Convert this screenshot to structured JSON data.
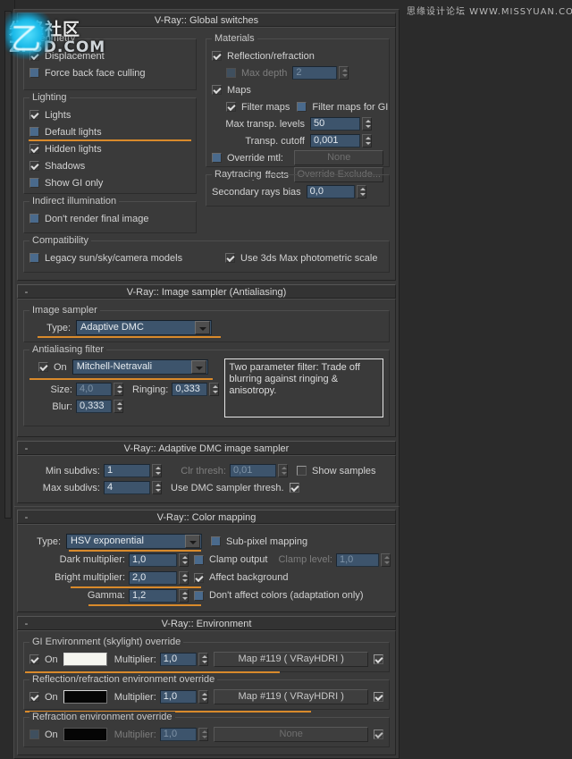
{
  "watermarks": {
    "right": "思缘设计论坛 WWW.MISSYUAN.COM",
    "left_cn": "朱峰社区",
    "left_domain": "ZF3D.COM"
  },
  "icons": {
    "collapse": "-",
    "spinner": "spinner-up-down-icon",
    "dropdown_arrow": "chevron-down-icon"
  },
  "rollouts": {
    "global_switches": {
      "title": "V-Ray:: Global switches",
      "geometry": {
        "legend": "Geometry",
        "displacement": {
          "label": "Displacement",
          "checked": true
        },
        "force_back_face_culling": {
          "label": "Force back face culling",
          "checked": false
        }
      },
      "lighting": {
        "legend": "Lighting",
        "lights": {
          "label": "Lights",
          "checked": true
        },
        "default_lights": {
          "label": "Default lights",
          "checked": false
        },
        "hidden_lights": {
          "label": "Hidden lights",
          "checked": true
        },
        "shadows": {
          "label": "Shadows",
          "checked": true
        },
        "show_gi_only": {
          "label": "Show GI only",
          "checked": false
        }
      },
      "indirect_illumination": {
        "legend": "Indirect illumination",
        "dont_render_final_image": {
          "label": "Don't render final image",
          "checked": false
        }
      },
      "compatibility": {
        "legend": "Compatibility",
        "legacy_sun": {
          "label": "Legacy sun/sky/camera models",
          "checked": false
        },
        "photometric_scale": {
          "label": "Use 3ds Max photometric scale",
          "checked": true
        }
      },
      "materials": {
        "legend": "Materials",
        "reflection_refraction": {
          "label": "Reflection/refraction",
          "checked": true
        },
        "max_depth": {
          "label": "Max depth",
          "checked": false,
          "value": "2"
        },
        "maps": {
          "label": "Maps",
          "checked": true
        },
        "filter_maps": {
          "label": "Filter maps",
          "checked": true
        },
        "filter_maps_gi": {
          "label": "Filter maps for GI",
          "checked": false
        },
        "max_transp_levels": {
          "label": "Max transp. levels",
          "value": "50"
        },
        "transp_cutoff": {
          "label": "Transp. cutoff",
          "value": "0,001"
        },
        "override_mtl": {
          "label": "Override mtl:",
          "checked": false,
          "button": "None"
        },
        "glossy_effects": {
          "label": "Glossy effects",
          "checked": true,
          "button": "Override Exclude..."
        }
      },
      "raytracing": {
        "legend": "Raytracing",
        "secondary_rays_bias": {
          "label": "Secondary rays bias",
          "value": "0,0"
        }
      }
    },
    "image_sampler": {
      "title": "V-Ray:: Image sampler (Antialiasing)",
      "sampler": {
        "legend": "Image sampler",
        "type_label": "Type:",
        "type_value": "Adaptive DMC"
      },
      "aa_filter": {
        "legend": "Antialiasing filter",
        "on_label": "On",
        "on_checked": true,
        "filter_value": "Mitchell-Netravali",
        "size_label": "Size:",
        "size_value": "4,0",
        "ringing_label": "Ringing:",
        "ringing_value": "0,333",
        "blur_label": "Blur:",
        "blur_value": "0,333",
        "description": "Two parameter filter: Trade off blurring against ringing & anisotropy."
      }
    },
    "adaptive_dmc": {
      "title": "V-Ray:: Adaptive DMC image sampler",
      "min_subdivs": {
        "label": "Min subdivs:",
        "value": "1"
      },
      "max_subdivs": {
        "label": "Max subdivs:",
        "value": "4"
      },
      "clr_thresh": {
        "label": "Clr thresh:",
        "value": "0,01"
      },
      "use_dmc_sampler_thresh": {
        "label": "Use DMC sampler thresh.",
        "checked": true
      },
      "show_samples": {
        "label": "Show samples",
        "checked": false
      }
    },
    "color_mapping": {
      "title": "V-Ray:: Color mapping",
      "type_label": "Type:",
      "type_value": "HSV exponential",
      "dark_multiplier": {
        "label": "Dark multiplier:",
        "value": "1,0"
      },
      "bright_multiplier": {
        "label": "Bright multiplier:",
        "value": "2,0"
      },
      "gamma": {
        "label": "Gamma:",
        "value": "1,2"
      },
      "sub_pixel_mapping": {
        "label": "Sub-pixel mapping",
        "checked": false
      },
      "clamp_output": {
        "label": "Clamp output",
        "checked": false
      },
      "clamp_level": {
        "label": "Clamp level:",
        "value": "1,0"
      },
      "affect_background": {
        "label": "Affect background",
        "checked": true
      },
      "dont_affect_colors": {
        "label": "Don't affect colors (adaptation only)",
        "checked": false
      }
    },
    "environment": {
      "title": "V-Ray:: Environment",
      "gi": {
        "legend": "GI Environment (skylight) override",
        "on_label": "On",
        "on_checked": true,
        "color": "#f5f5ef",
        "multiplier_label": "Multiplier:",
        "multiplier_value": "1,0",
        "map_button": "Map #119  ( VRayHDRI )",
        "map_enabled": true
      },
      "reflection": {
        "legend": "Reflection/refraction environment override",
        "on_label": "On",
        "on_checked": true,
        "color": "#050505",
        "multiplier_label": "Multiplier:",
        "multiplier_value": "1,0",
        "map_button": "Map #119  ( VRayHDRI )",
        "map_enabled": true
      },
      "refraction": {
        "legend": "Refraction environment override",
        "on_label": "On",
        "on_checked": false,
        "color": "#050505",
        "multiplier_label": "Multiplier:",
        "multiplier_value": "1,0",
        "map_button": "None",
        "map_enabled": true
      }
    }
  },
  "colors": {
    "panel_bg": "#383838",
    "rollout_bg": "#3a3a3a",
    "field_blue": "#3d546c",
    "animate_orange": "#d98a2b",
    "desktop_bg": "#2b2b2b"
  }
}
